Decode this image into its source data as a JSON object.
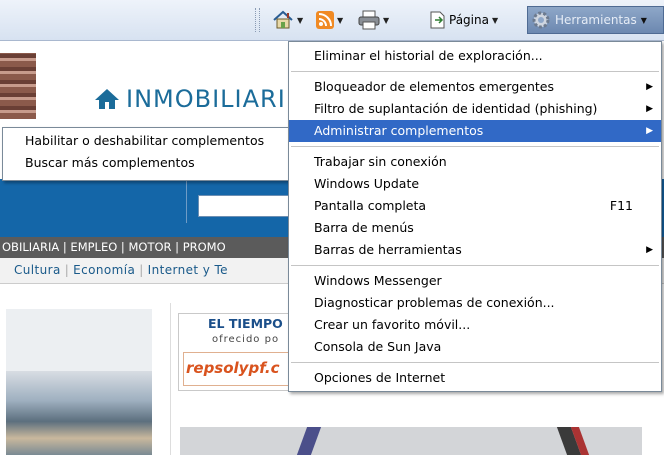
{
  "toolbar": {
    "home_icon": "home-icon",
    "feeds_icon": "rss-feed-icon",
    "print_icon": "printer-icon",
    "page_label": "Página",
    "tools_label": "Herramientas"
  },
  "page": {
    "logo_text": "INMOBILIARI",
    "nav_tabs": "OBILIARIA | EMPLEO | MOTOR | PROMO",
    "subnav": [
      "Cultura",
      "Economía",
      "Internet y Te"
    ],
    "weather_title": "EL TIEMPO",
    "weather_sub": "ofrecido po",
    "sponsor": "repsolypf.c"
  },
  "tools_menu": {
    "items": [
      {
        "label": "Eliminar el historial de exploración..."
      },
      {
        "label": "Bloqueador de elementos emergentes"
      },
      {
        "label": "Filtro de suplantación de identidad (phishing)"
      },
      {
        "label": "Administrar complementos"
      },
      {
        "label": "Trabajar sin conexión"
      },
      {
        "label": "Windows Update"
      },
      {
        "label": "Pantalla completa",
        "shortcut": "F11"
      },
      {
        "label": "Barra de menús"
      },
      {
        "label": "Barras de herramientas"
      },
      {
        "label": "Windows Messenger"
      },
      {
        "label": "Diagnosticar problemas de conexión..."
      },
      {
        "label": "Crear un favorito móvil..."
      },
      {
        "label": "Consola de Sun Java"
      },
      {
        "label": "Opciones de Internet"
      }
    ]
  },
  "addons_submenu": {
    "items": [
      {
        "label": "Habilitar o deshabilitar complementos"
      },
      {
        "label": "Buscar más complementos"
      }
    ]
  },
  "colors": {
    "highlight": "#3169c6",
    "page_blue": "#1466a8"
  }
}
